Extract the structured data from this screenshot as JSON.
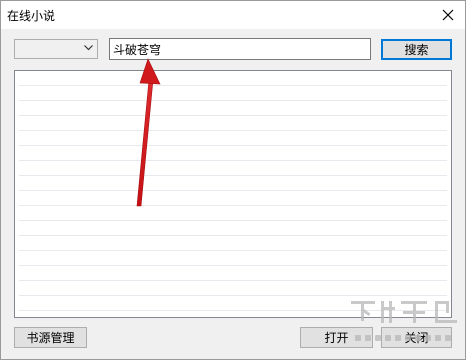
{
  "window": {
    "title": "在线小说"
  },
  "toolbar": {
    "source_select_value": "",
    "search_value": "斗破苍穹",
    "search_button": "搜索"
  },
  "results": {
    "items": []
  },
  "footer": {
    "source_manage_button": "书源管理",
    "open_button": "打开",
    "close_button": "关闭"
  },
  "watermark": {
    "text": "下载吧"
  },
  "colors": {
    "focus_border": "#0078d7",
    "annotation_arrow": "#d0191c",
    "window_bg": "#f0f0f0"
  },
  "icons": {
    "window_close": "close-icon",
    "combo": "chevron-down-icon"
  }
}
